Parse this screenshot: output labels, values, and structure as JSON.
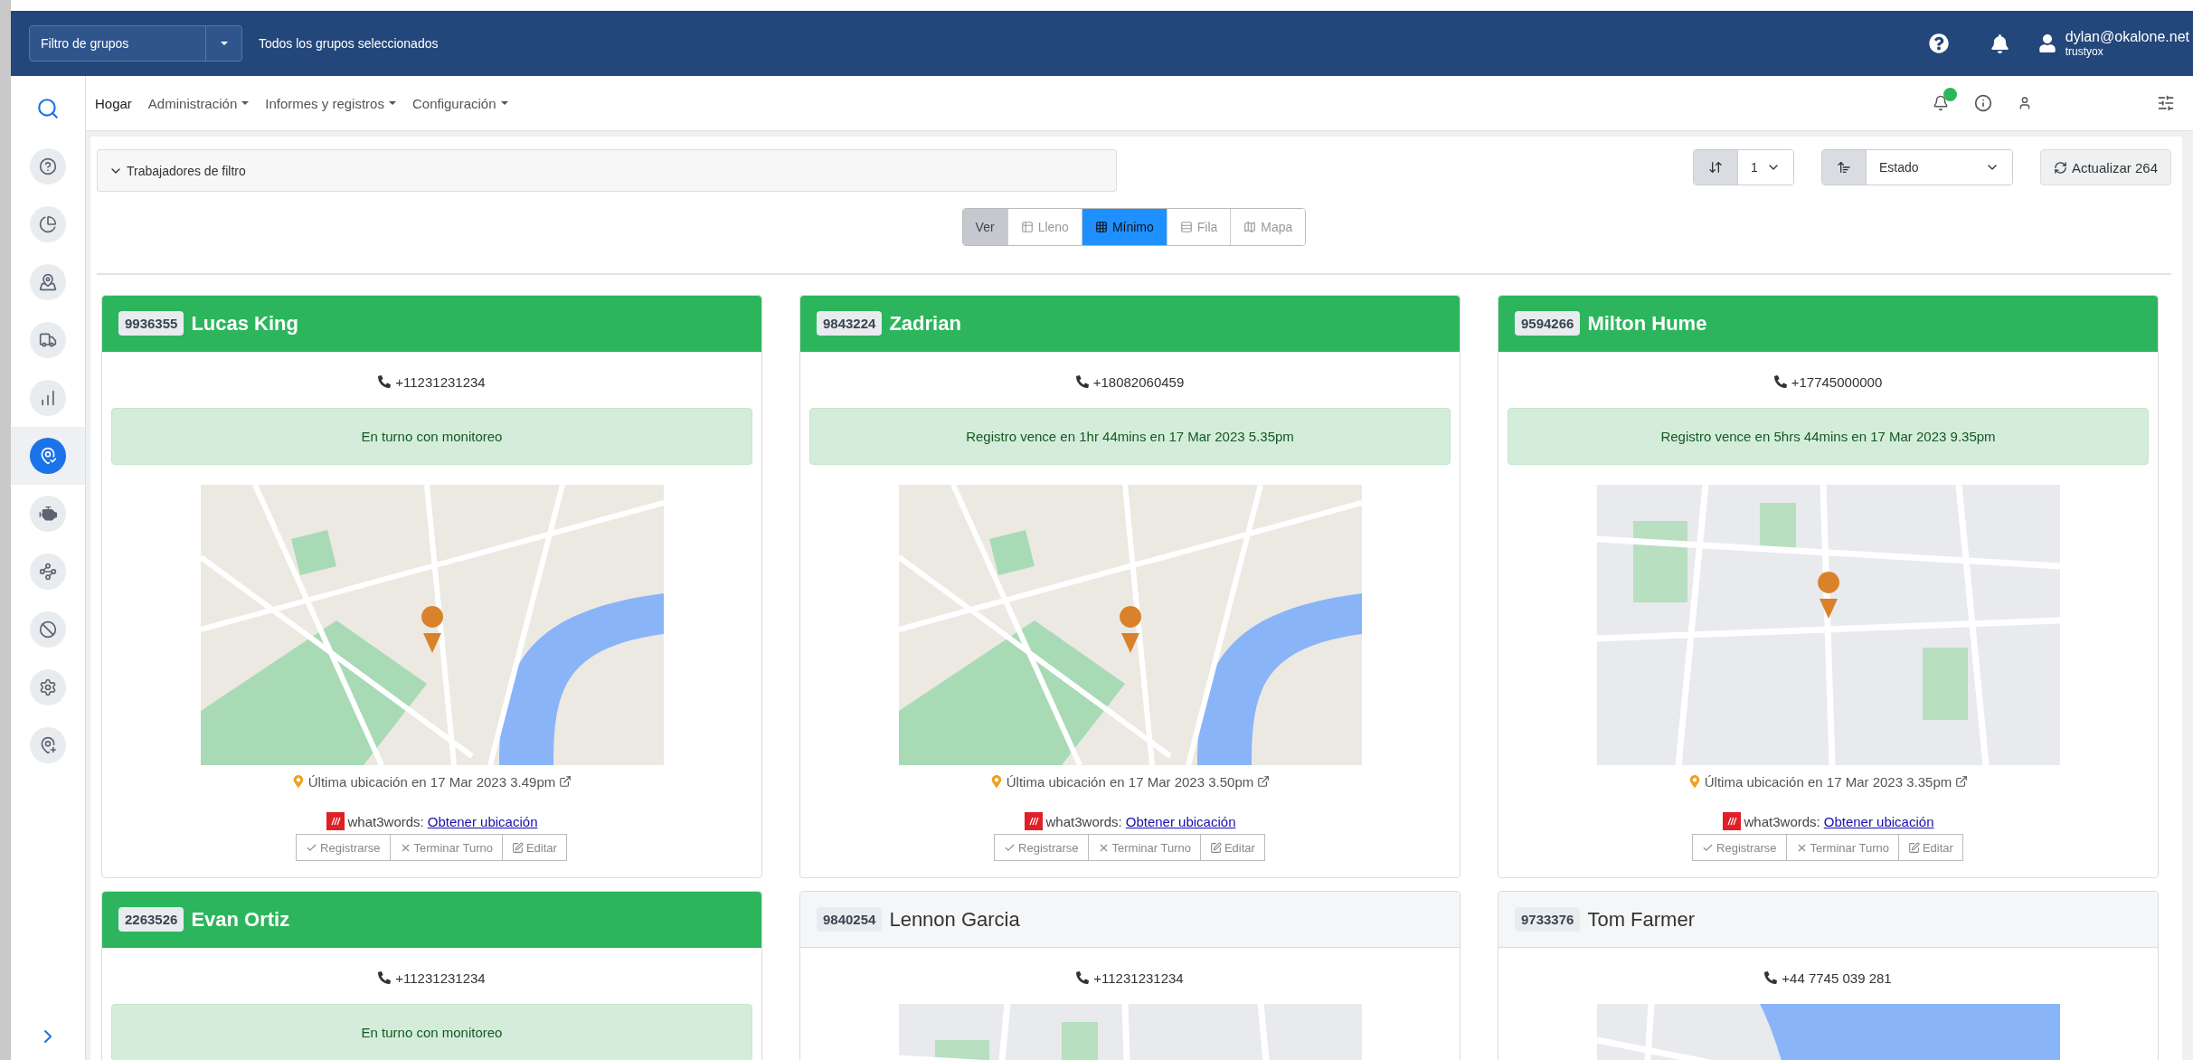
{
  "topbar": {
    "group_filter": "Filtro de grupos",
    "selection": "Todos los grupos seleccionados",
    "user": {
      "email": "dylan@okalone.net",
      "org": "trustyox"
    }
  },
  "nav": {
    "items": [
      {
        "label": "Hogar",
        "dropdown": false
      },
      {
        "label": "Administración",
        "dropdown": true
      },
      {
        "label": "Informes y registros",
        "dropdown": true
      },
      {
        "label": "Configuración",
        "dropdown": true
      }
    ],
    "notification_dot": true
  },
  "sidebar": {
    "items": [
      {
        "selected": false
      },
      {
        "selected": false
      },
      {
        "selected": false
      },
      {
        "selected": false
      },
      {
        "selected": false
      },
      {
        "selected": true
      },
      {
        "selected": false
      },
      {
        "selected": false
      },
      {
        "selected": false
      },
      {
        "selected": false
      },
      {
        "selected": false
      }
    ]
  },
  "filter": {
    "label": "Trabajadores de filtro",
    "expanded": false
  },
  "sort": {
    "count": "1",
    "field": "Estado"
  },
  "refresh": "Actualizar 264",
  "view": {
    "label": "Ver",
    "options": [
      {
        "label": "Lleno",
        "selected": false
      },
      {
        "label": "Mínimo",
        "selected": true
      },
      {
        "label": "Fila",
        "selected": false
      },
      {
        "label": "Mapa",
        "selected": false
      }
    ]
  },
  "workers": [
    {
      "id": "9936355",
      "name": "Lucas King",
      "on_shift": true,
      "phone": "+11231231234",
      "status": "En turno con monitoreo",
      "map": {
        "kind": "city"
      },
      "last_location": "Última ubicación en 17 Mar 2023 3.49pm",
      "w3w_label": "what3words:",
      "w3w_link": "Obtener ubicación",
      "actions": [
        {
          "kind": "check",
          "label": "Registrarse"
        },
        {
          "kind": "end",
          "label": "Terminar Turno"
        },
        {
          "kind": "edit",
          "label": "Editar"
        }
      ]
    },
    {
      "id": "9843224",
      "name": "Zadrian",
      "on_shift": true,
      "phone": "+18082060459",
      "status": "Registro vence en 1hr 44mins en 17 Mar 2023 5.35pm",
      "map": {
        "kind": "city"
      },
      "last_location": "Última ubicación en 17 Mar 2023 3.50pm",
      "w3w_label": "what3words:",
      "w3w_link": "Obtener ubicación",
      "actions": [
        {
          "kind": "check",
          "label": "Registrarse"
        },
        {
          "kind": "end",
          "label": "Terminar Turno"
        },
        {
          "kind": "edit",
          "label": "Editar"
        }
      ]
    },
    {
      "id": "9594266",
      "name": "Milton Hume",
      "on_shift": true,
      "phone": "+17745000000",
      "status": "Registro vence en 5hrs 44mins en 17 Mar 2023 9.35pm",
      "map": {
        "kind": "suburb"
      },
      "last_location": "Última ubicación en 17 Mar 2023 3.35pm",
      "w3w_label": "what3words:",
      "w3w_link": "Obtener ubicación",
      "actions": [
        {
          "kind": "check",
          "label": "Registrarse"
        },
        {
          "kind": "end",
          "label": "Terminar Turno"
        },
        {
          "kind": "edit",
          "label": "Editar"
        }
      ]
    },
    {
      "id": "2263526",
      "name": "Evan Ortiz",
      "on_shift": true,
      "phone": "+11231231234",
      "status": "En turno con monitoreo"
    },
    {
      "id": "9840254",
      "name": "Lennon Garcia",
      "on_shift": false,
      "phone": "+11231231234",
      "map": {
        "kind": "suburb"
      }
    },
    {
      "id": "9733376",
      "name": "Tom Farmer",
      "on_shift": false,
      "phone": "+44 7745 039 281",
      "map": {
        "kind": "coast"
      }
    }
  ]
}
